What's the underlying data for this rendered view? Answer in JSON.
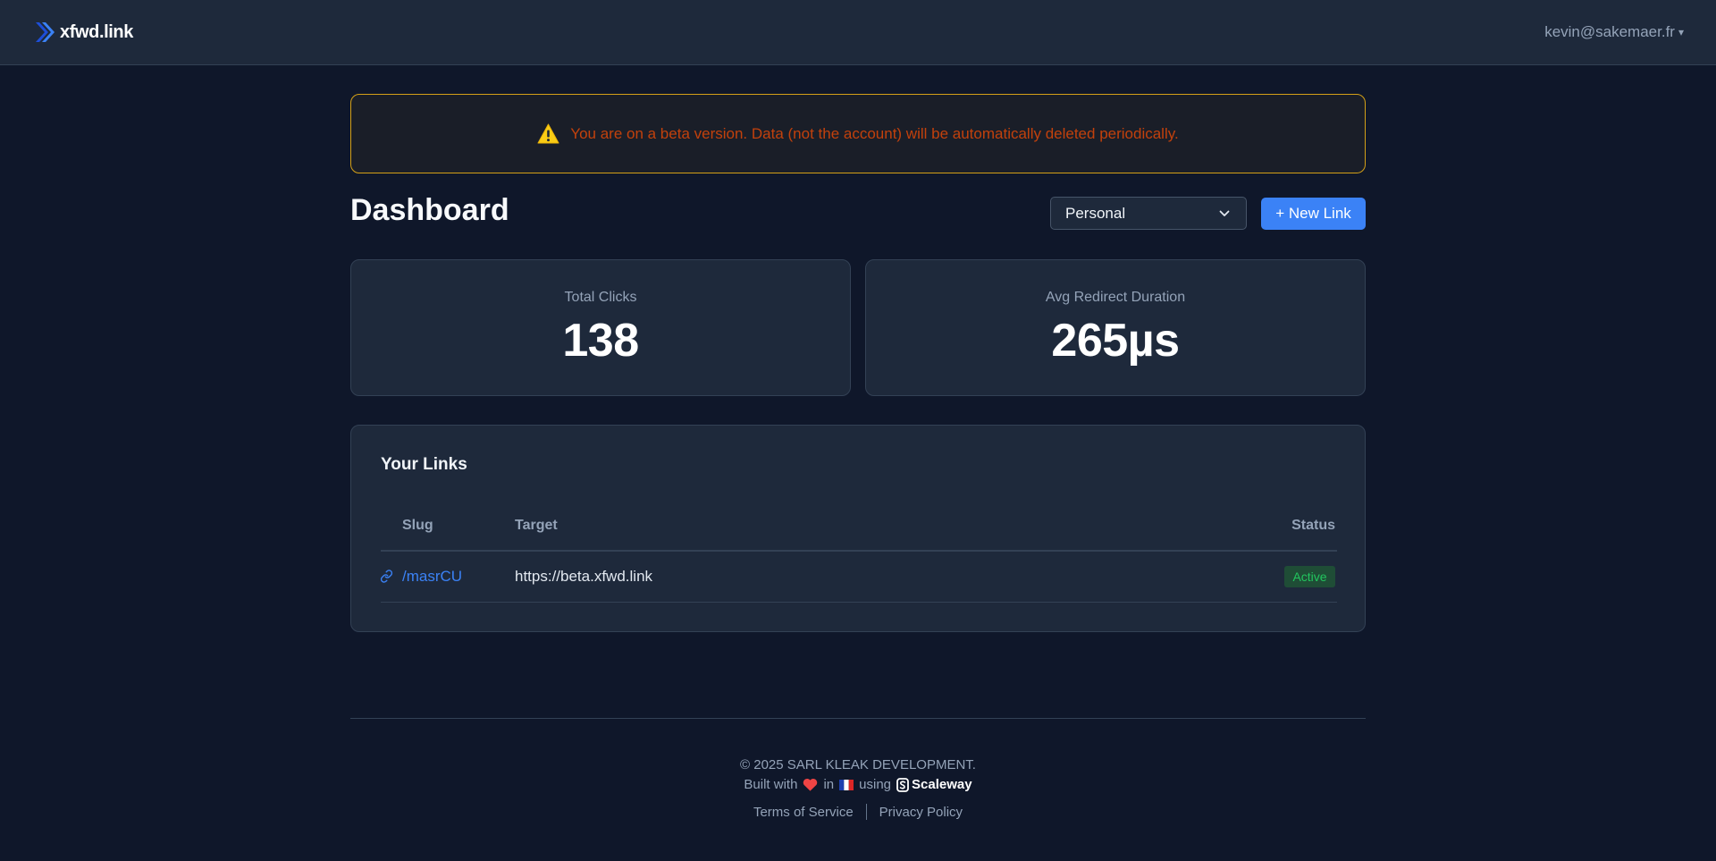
{
  "header": {
    "brand": "xfwd.link",
    "user_email": "kevin@sakemaer.fr",
    "user_caret": "▾"
  },
  "notice": {
    "icon": "warning-icon",
    "text": "You are on a beta version. Data (not the account) will be automatically deleted periodically."
  },
  "dashboard": {
    "title": "Dashboard",
    "workspace_selected": "Personal",
    "new_link_label": "+ New Link"
  },
  "stats": [
    {
      "label": "Total Clicks",
      "value": "138"
    },
    {
      "label": "Avg Redirect Duration",
      "value": "265µs"
    }
  ],
  "links": {
    "title": "Your Links",
    "columns": [
      "Slug",
      "Target",
      "Status"
    ],
    "rows": [
      {
        "slug": "/masrCU",
        "target": "https://beta.xfwd.link",
        "status": "Active"
      }
    ]
  },
  "footer": {
    "copyright": "© 2025 SARL KLEAK DEVELOPMENT.",
    "built_with": "Built with",
    "in": "in",
    "using": "using",
    "provider": "Scaleway",
    "terms": "Terms of Service",
    "privacy": "Privacy Policy"
  },
  "colors": {
    "background": "#0f172a",
    "surface": "#1e293b",
    "accent": "#3b82f6",
    "warning_border": "#d4a017",
    "warning_text": "#c2410c",
    "success": "#22c55e"
  }
}
